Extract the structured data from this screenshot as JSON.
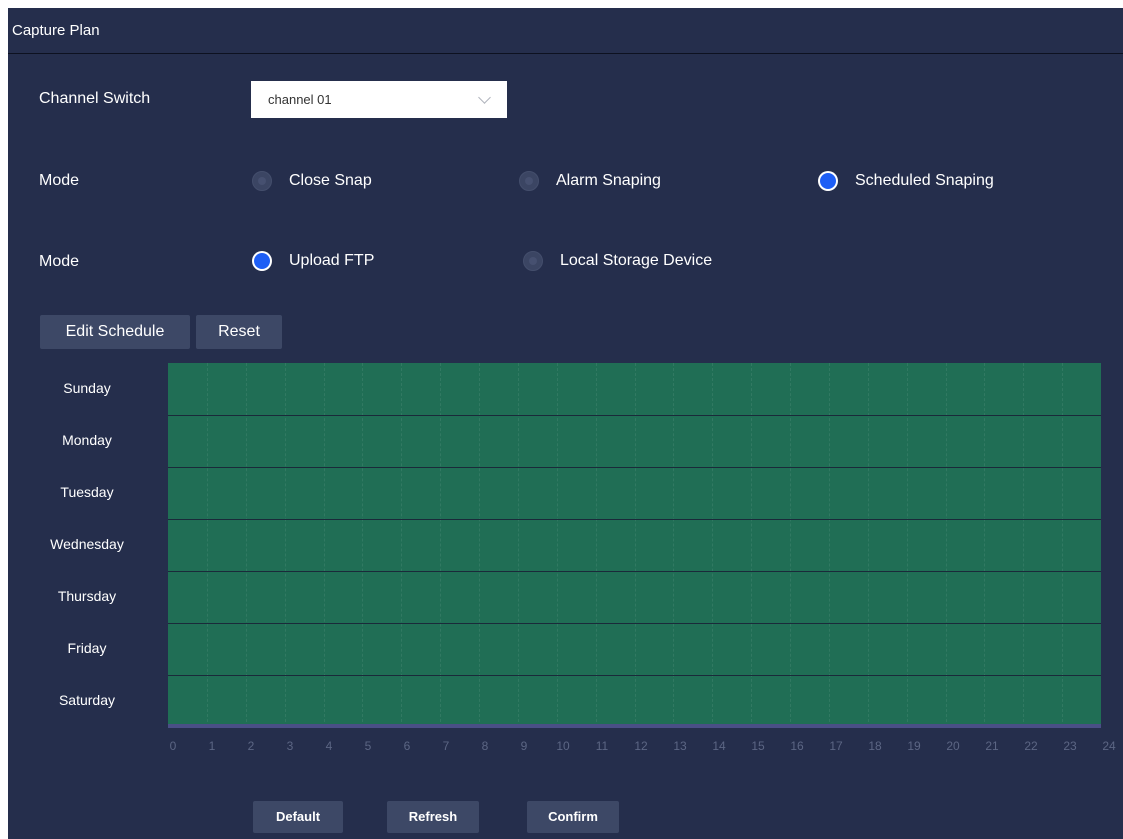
{
  "title": "Capture Plan",
  "channel": {
    "label": "Channel Switch",
    "selected": "channel 01"
  },
  "snap_mode": {
    "label": "Mode",
    "options": [
      {
        "label": "Close Snap",
        "selected": false
      },
      {
        "label": "Alarm Snaping",
        "selected": false
      },
      {
        "label": "Scheduled Snaping",
        "selected": true
      }
    ]
  },
  "storage_mode": {
    "label": "Mode",
    "options": [
      {
        "label": "Upload FTP",
        "selected": true
      },
      {
        "label": "Local Storage Device",
        "selected": false
      }
    ]
  },
  "schedule": {
    "edit_label": "Edit Schedule",
    "reset_label": "Reset",
    "days": [
      "Sunday",
      "Monday",
      "Tuesday",
      "Wednesday",
      "Thursday",
      "Friday",
      "Saturday"
    ],
    "hours": [
      "0",
      "1",
      "2",
      "3",
      "4",
      "5",
      "6",
      "7",
      "8",
      "9",
      "10",
      "11",
      "12",
      "13",
      "14",
      "15",
      "16",
      "17",
      "18",
      "19",
      "20",
      "21",
      "22",
      "23",
      "24"
    ],
    "fill_color": "#206e55",
    "coverage": "all days 0-24 scheduled"
  },
  "footer": {
    "default_label": "Default",
    "refresh_label": "Refresh",
    "confirm_label": "Confirm"
  },
  "colors": {
    "background": "#252e4c",
    "accent": "#1e5ef5",
    "button": "#3d4866",
    "schedule": "#206e55"
  }
}
